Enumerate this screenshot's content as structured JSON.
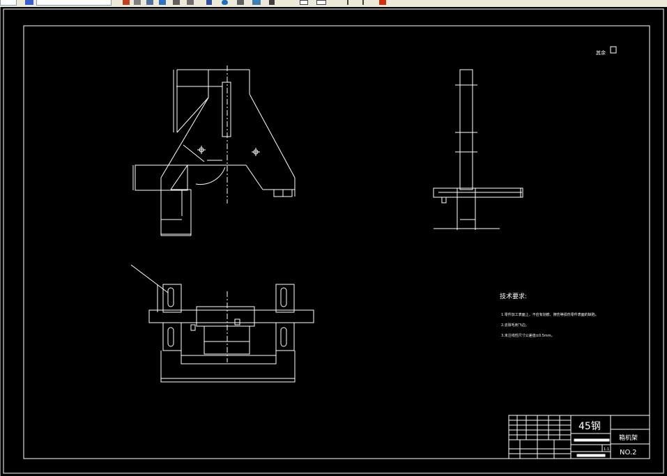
{
  "drawing": {
    "title_block": {
      "material": "45钢",
      "part_name": "箱机架",
      "drawing_number": "NO.2",
      "scale": "1:1"
    },
    "technical_requirements": {
      "heading": "技术要求:",
      "items": [
        "1.零件加工表面上，不应有划痕、擦伤等损伤零件表面的缺陷。",
        "2.去除毛刺飞边。",
        "3.未注线性尺寸公差值±0.5mm。"
      ]
    },
    "roughness_note": "其余"
  },
  "colors": {
    "background": "#000000",
    "lines": "#ffffff",
    "toolbar": "#ece9d8"
  }
}
